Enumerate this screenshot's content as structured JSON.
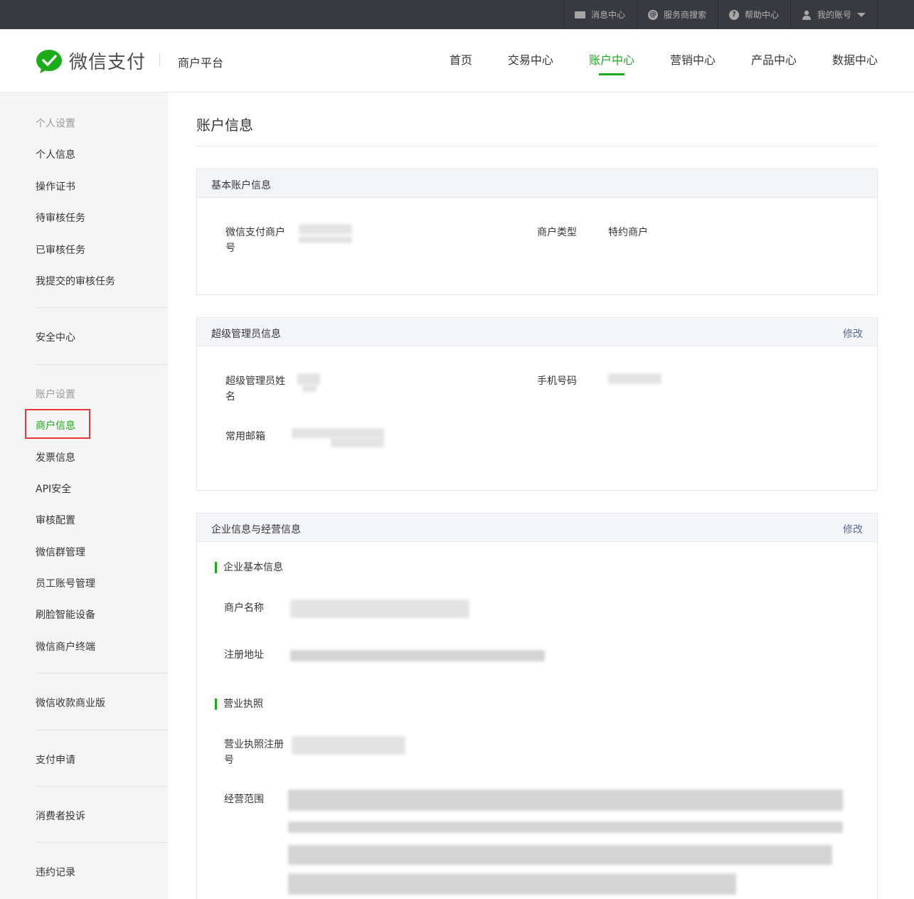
{
  "topbar": {
    "items": [
      {
        "label": "消息中心",
        "icon": "envelope-icon"
      },
      {
        "label": "服务商搜索",
        "icon": "search-circle-icon"
      },
      {
        "label": "帮助中心",
        "icon": "question-icon"
      },
      {
        "label": "我的账号",
        "icon": "user-icon"
      }
    ]
  },
  "header": {
    "logo_text": "微信支付",
    "platform": "商户平台",
    "nav": [
      "首页",
      "交易中心",
      "账户中心",
      "营销中心",
      "产品中心",
      "数据中心"
    ],
    "active_nav": "账户中心"
  },
  "sidebar": {
    "personal_title": "个人设置",
    "personal_items": [
      "个人信息",
      "操作证书",
      "待审核任务",
      "已审核任务",
      "我提交的审核任务"
    ],
    "security": "安全中心",
    "account_title": "账户设置",
    "account_items": [
      "商户信息",
      "发票信息",
      "API安全",
      "审核配置",
      "微信群管理",
      "员工账号管理",
      "刷脸智能设备",
      "微信商户终端"
    ],
    "pro": "微信收款商业版",
    "pay_apply": "支付申请",
    "complaint": "消费者投诉",
    "violation": "违约记录"
  },
  "main": {
    "page_title": "账户信息",
    "basic": {
      "title": "基本账户信息",
      "merchant_id_label": "微信支付商户号",
      "merchant_type_label": "商户类型",
      "merchant_type_value": "特约商户"
    },
    "admin": {
      "title": "超级管理员信息",
      "edit": "修改",
      "name_label": "超级管理员姓名",
      "phone_label": "手机号码",
      "email_label": "常用邮箱"
    },
    "enterprise": {
      "title": "企业信息与经营信息",
      "edit": "修改",
      "basic_sub": "企业基本信息",
      "name_label": "商户名称",
      "address_label": "注册地址",
      "license_sub": "营业执照",
      "license_no_label": "营业执照注册号",
      "scope_label": "经营范围"
    }
  },
  "colors": {
    "accent": "#1aad19",
    "link": "#576b95",
    "topbar": "#393a3f",
    "highlight_box": "#e4393c"
  }
}
